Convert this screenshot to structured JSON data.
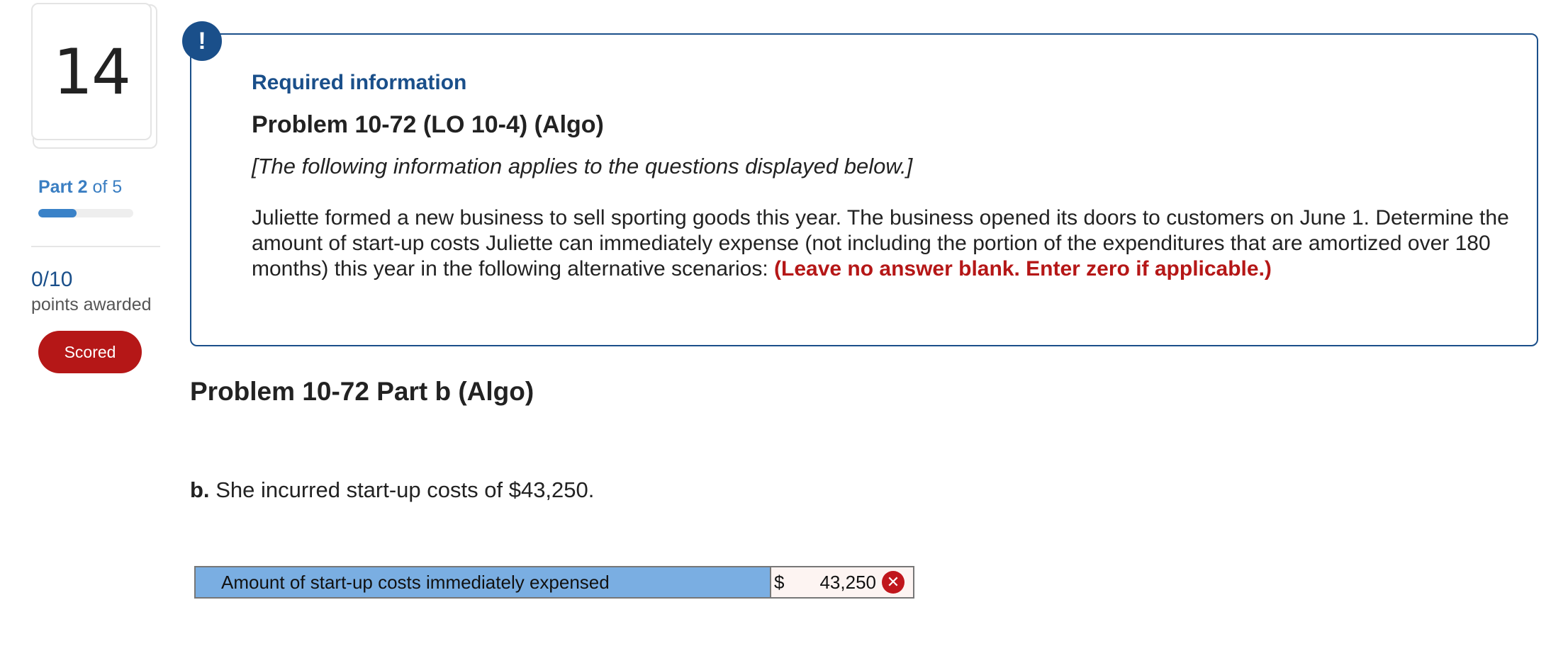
{
  "question": {
    "number": "14"
  },
  "rail": {
    "part_current": "Part 2",
    "part_total": "of 5",
    "progress_fraction": 0.4,
    "score": "0/10",
    "points_label": "points awarded",
    "scored_label": "Scored"
  },
  "info": {
    "icon": "exclamation-icon",
    "heading": "Required information",
    "problem_title": "Problem 10-72 (LO 10-4) (Algo)",
    "applies_note": "[The following information applies to the questions displayed below.]",
    "body": "Juliette formed a new business to sell sporting goods this year. The business opened its doors to customers on June 1. Determine the amount of start-up costs Juliette can immediately expense (not including the portion of the expenditures that are amortized over 180 months) this year in the following alternative scenarios: ",
    "instruction": "(Leave no answer blank. Enter zero if applicable.)"
  },
  "part": {
    "title": "Problem 10-72 Part b (Algo)",
    "question_letter": "b.",
    "question_text": "She incurred start-up costs of $43,250."
  },
  "answer": {
    "label": "Amount of start-up costs immediately expensed",
    "currency": "$",
    "value": "43,250",
    "status_icon": "incorrect-x-icon"
  },
  "colors": {
    "brand_blue": "#1a4f8a",
    "link_blue": "#3a7ec2",
    "error_red": "#b51717",
    "answer_label_bg": "#7aaee2"
  }
}
